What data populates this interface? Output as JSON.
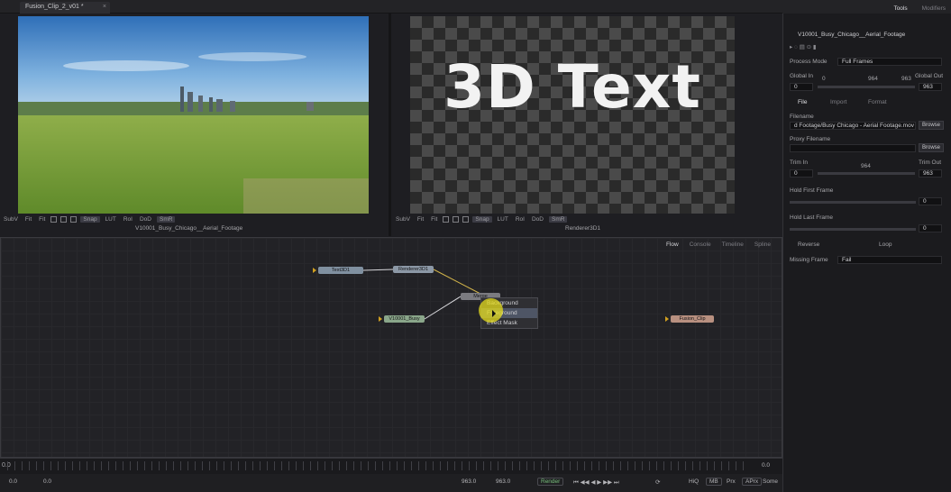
{
  "tab": {
    "title": "Fusion_Clip_2_v01 *",
    "close": "×"
  },
  "viewers": {
    "left": {
      "name": "V10001_Busy_Chicago__Aerial_Footage",
      "toolbar": [
        "SubV",
        "Fit",
        "Fit",
        "Snap",
        "LUT",
        "RoI",
        "DoD",
        "SmR"
      ]
    },
    "right": {
      "name": "Renderer3D1",
      "overlay_text": "3D Text",
      "toolbar": [
        "SubV",
        "Fit",
        "Fit",
        "Snap",
        "LUT",
        "RoI",
        "DoD",
        "SmR"
      ]
    }
  },
  "node_editor": {
    "tabs": [
      "Flow",
      "Console",
      "Timeline",
      "Spline"
    ],
    "nodes": {
      "text": "Text3D1",
      "renderer": "Renderer3D1",
      "merge": "Merge",
      "clip": "V10001_Busy",
      "output": "Fusion_Clip"
    },
    "context_menu": [
      "Background",
      "Foreground",
      "Effect Mask"
    ]
  },
  "timeline": {
    "start": "0.0",
    "end": "0.0"
  },
  "transport": {
    "left": "0.0",
    "left2": "0.0",
    "in": "963.0",
    "out": "963.0",
    "render": "Render",
    "hiq": "HiQ",
    "mb": "MB",
    "prx": "Prx",
    "aprx": "APrx",
    "some": "Some"
  },
  "inspector": {
    "tabs": [
      "Tools",
      "Modifiers"
    ],
    "node_name": "V10001_Busy_Chicago__Aerial_Footage",
    "process_mode_label": "Process Mode",
    "process_mode_value": "Full Frames",
    "global_in_label": "Global In",
    "global_out_label": "Global Out",
    "global_in_value": "0",
    "global_out_value": "963",
    "scale_a": "0",
    "scale_b": "964",
    "scale_c": "963",
    "subtabs": [
      "File",
      "Import",
      "Format"
    ],
    "filename_label": "Filename",
    "filename_value": "d Footage/Busy Chicago - Aerial Footage.mov",
    "browse": "Browse",
    "proxy_label": "Proxy Filename",
    "trim_in_label": "Trim In",
    "trim_out_label": "Trim Out",
    "trim_in_value": "0",
    "trim_out_value": "963",
    "trim_scale": "964",
    "hold_first_label": "Hold First Frame",
    "hold_first_value": "0",
    "hold_last_label": "Hold Last Frame",
    "hold_last_value": "0",
    "reverse_label": "Reverse",
    "loop_label": "Loop",
    "missing_label": "Missing Frame",
    "missing_value": "Fail"
  }
}
